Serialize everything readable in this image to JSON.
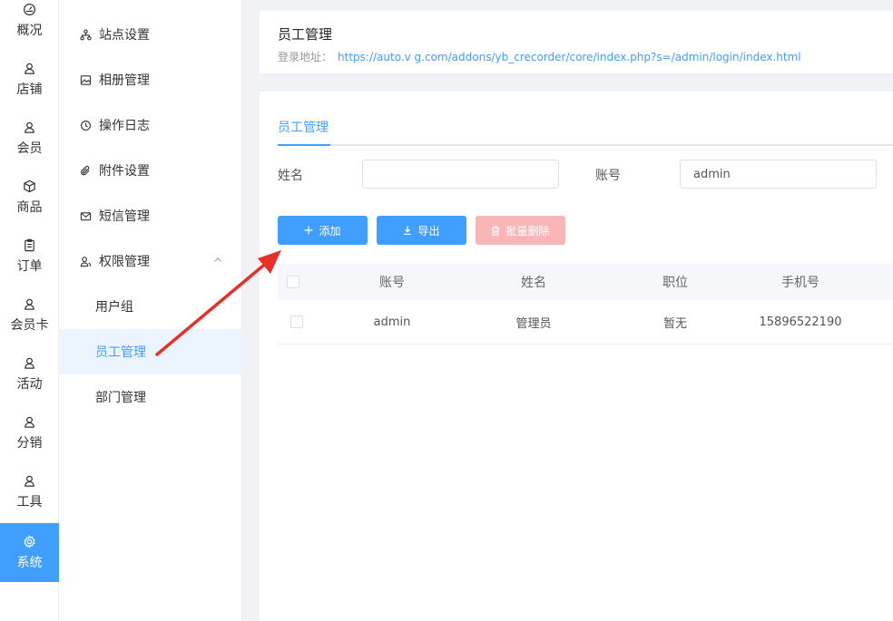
{
  "nav": {
    "items": [
      {
        "label": "概况",
        "icon": "dashboard-icon"
      },
      {
        "label": "店铺",
        "icon": "user-icon"
      },
      {
        "label": "会员",
        "icon": "user-icon"
      },
      {
        "label": "商品",
        "icon": "box-icon"
      },
      {
        "label": "订单",
        "icon": "clipboard-icon"
      },
      {
        "label": "会员卡",
        "icon": "user-icon"
      },
      {
        "label": "活动",
        "icon": "user-icon"
      },
      {
        "label": "分销",
        "icon": "user-icon"
      },
      {
        "label": "工具",
        "icon": "user-icon"
      },
      {
        "label": "系统",
        "icon": "gear-icon"
      }
    ],
    "active": "系统"
  },
  "menu": {
    "items": [
      {
        "label": "站点设置",
        "icon": "sitemap-icon"
      },
      {
        "label": "相册管理",
        "icon": "image-icon"
      },
      {
        "label": "操作日志",
        "icon": "history-icon"
      },
      {
        "label": "附件设置",
        "icon": "paperclip-icon"
      },
      {
        "label": "短信管理",
        "icon": "mail-icon"
      },
      {
        "label": "权限管理",
        "icon": "user-group-icon"
      }
    ],
    "sub_items": [
      "用户组",
      "员工管理",
      "部门管理"
    ],
    "active": "员工管理"
  },
  "header": {
    "title": "员工管理",
    "login_label": "登录地址：",
    "login_url": "https://auto.v        g.com/addons/yb_crecorder/core/index.php?s=/admin/login/index.html"
  },
  "tab": "员工管理",
  "filters": {
    "name_label": "姓名",
    "name_value": "",
    "account_label": "账号",
    "account_value": "admin"
  },
  "buttons": {
    "add": "添加",
    "export": "导出",
    "batch_delete": "批量删除"
  },
  "table": {
    "columns": [
      "账号",
      "姓名",
      "职位",
      "手机号"
    ],
    "rows": [
      {
        "account": "admin",
        "name": "管理员",
        "position": "暂无",
        "phone": "15896522190"
      }
    ]
  },
  "colors": {
    "primary": "#409eff",
    "danger_disabled": "#fab6b6",
    "annotation_arrow": "#e8302a"
  }
}
